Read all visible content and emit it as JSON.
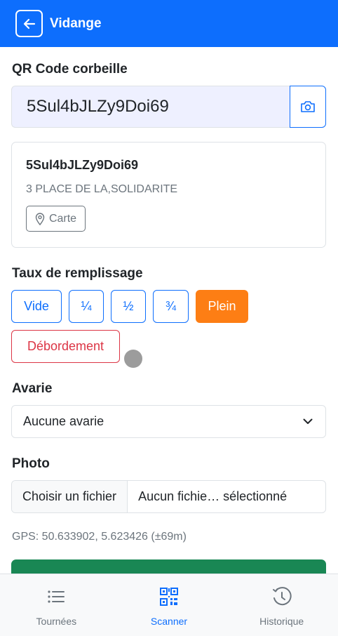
{
  "header": {
    "title": "Vidange",
    "back_icon": "arrow-left-icon"
  },
  "qr": {
    "label": "QR Code corbeille",
    "value": "5Sul4bJLZy9Doi69",
    "camera_icon": "camera-icon"
  },
  "bin": {
    "id": "5Sul4bJLZy9Doi69",
    "address": "3 PLACE DE LA,SOLIDARITE",
    "map_label": "Carte",
    "map_icon": "map-pin-icon"
  },
  "fill": {
    "label": "Taux de remplissage",
    "options": [
      "Vide",
      "¼",
      "½",
      "¾",
      "Plein"
    ],
    "selected": "Plein",
    "overflow_label": "Débordement"
  },
  "damage": {
    "label": "Avarie",
    "selected": "Aucune avarie"
  },
  "photo": {
    "label": "Photo",
    "choose_label": "Choisir un fichier",
    "file_status": "Aucun fichie… sélectionné"
  },
  "gps": {
    "text": "GPS: 50.633902, 5.623426 (±69m)"
  },
  "nav": {
    "items": [
      {
        "label": "Tournées",
        "icon": "list-icon",
        "active": false
      },
      {
        "label": "Scanner",
        "icon": "qr-code-icon",
        "active": true
      },
      {
        "label": "Historique",
        "icon": "clock-icon",
        "active": false
      }
    ]
  },
  "colors": {
    "primary": "#0d6efd",
    "selected_fill": "#fd7e14",
    "danger": "#dc3545",
    "success": "#198754"
  }
}
